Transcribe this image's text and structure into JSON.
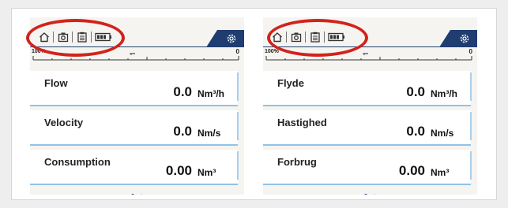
{
  "colors": {
    "navy": "#1f3d70",
    "highlight_ring": "#d1231c",
    "accent_line": "#8fc3e8"
  },
  "icons": [
    "home-icon",
    "camera-icon",
    "clipboard-icon",
    "battery-icon",
    "gear-icon"
  ],
  "screens": [
    {
      "language": "english",
      "scale": {
        "max": "100%",
        "zero": "0"
      },
      "panels": [
        {
          "label": "Flow",
          "value": "0.0",
          "unit": "Nm³/h"
        },
        {
          "label": "Velocity",
          "value": "0.0",
          "unit": "Nm/s"
        },
        {
          "label": "Consumption",
          "value": "0.00",
          "unit": "Nm³"
        }
      ],
      "page_indicator": {
        "pages": 2,
        "current": 1
      }
    },
    {
      "language": "danish",
      "scale": {
        "max": "100%",
        "zero": "0"
      },
      "panels": [
        {
          "label": "Flyde",
          "value": "0.0",
          "unit": "Nm³/h"
        },
        {
          "label": "Hastighed",
          "value": "0.0",
          "unit": "Nm/s"
        },
        {
          "label": "Forbrug",
          "value": "0.00",
          "unit": "Nm³"
        }
      ],
      "page_indicator": {
        "pages": 2,
        "current": 1
      }
    }
  ]
}
